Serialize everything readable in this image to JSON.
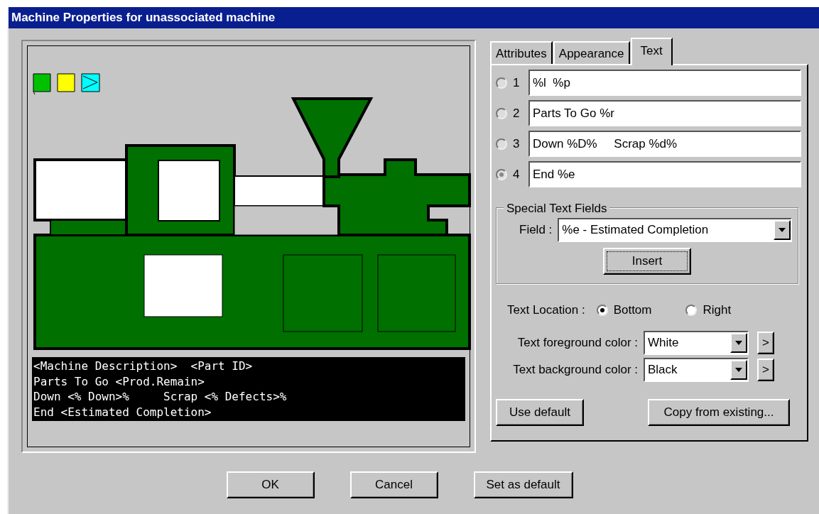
{
  "window": {
    "title": "Machine Properties for unassociated machine"
  },
  "preview": {
    "text_lines": [
      "<Machine Description>  <Part ID>",
      "Parts To Go <Prod.Remain>",
      "Down <% Down>%     Scrap <% Defects>%",
      "End <Estimated Completion>"
    ]
  },
  "tabs": [
    {
      "label": "Attributes",
      "selected": false
    },
    {
      "label": "Appearance",
      "selected": false
    },
    {
      "label": "Text",
      "selected": true
    }
  ],
  "text_lines": [
    {
      "number": "1",
      "value": "%l  %p",
      "selected": false
    },
    {
      "number": "2",
      "value": "Parts To Go %r",
      "selected": false
    },
    {
      "number": "3",
      "value": "Down %D%     Scrap %d%",
      "selected": false
    },
    {
      "number": "4",
      "value": "End %e",
      "selected": true
    }
  ],
  "special_text_fields": {
    "title": "Special Text Fields",
    "field_label": "Field :",
    "field_value": "%e - Estimated Completion",
    "insert_button": "Insert"
  },
  "text_location": {
    "label": "Text Location :",
    "options": [
      {
        "label": "Bottom",
        "selected": true
      },
      {
        "label": "Right",
        "selected": false
      }
    ]
  },
  "colors": [
    {
      "label": "Text foreground color :",
      "value": "White",
      "more_button": ">"
    },
    {
      "label": "Text background color :",
      "value": "Black",
      "more_button": ">"
    }
  ],
  "panel_buttons": [
    "Use default",
    "Copy from existing..."
  ],
  "buttons": [
    "OK",
    "Cancel",
    "Set as default"
  ]
}
